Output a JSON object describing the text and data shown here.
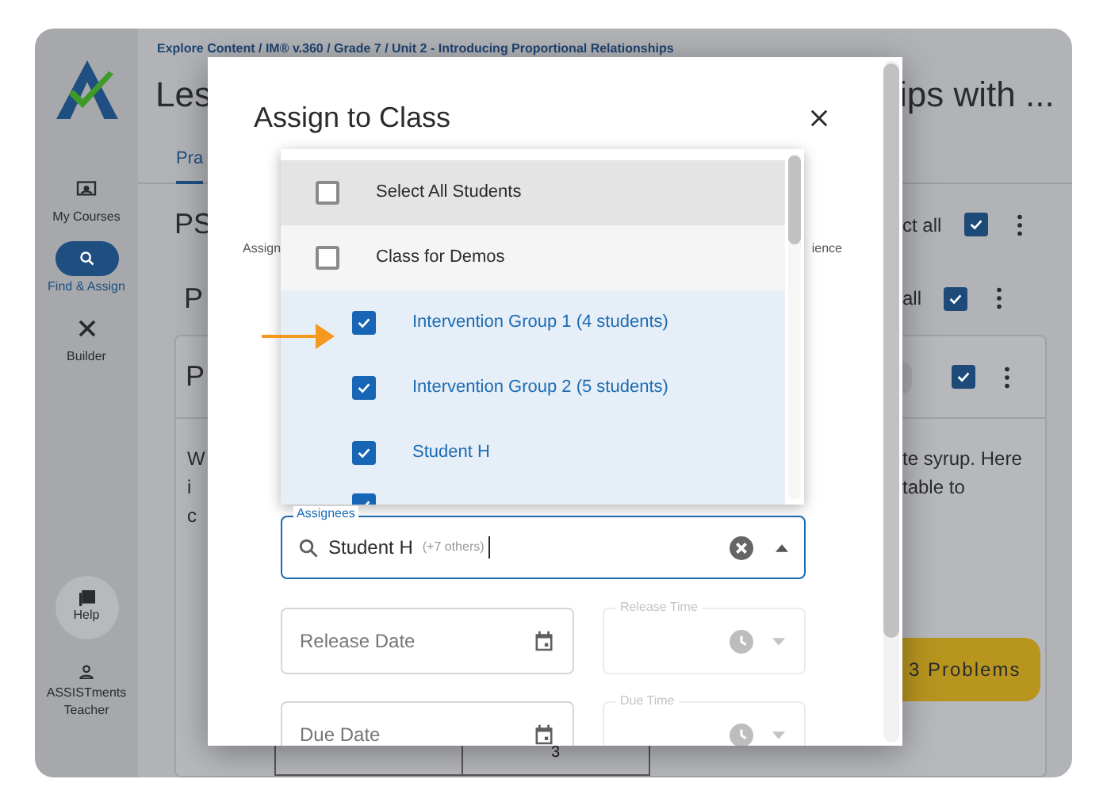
{
  "breadcrumb": "Explore Content / IM® v.360 / Grade 7 / Unit 2 - Introducing Proportional Relationships",
  "sidebar": {
    "items": [
      {
        "label": "My Courses",
        "selected": false
      },
      {
        "label": "Find & Assign",
        "selected": true
      },
      {
        "label": "Builder",
        "selected": false
      }
    ],
    "help": "Help",
    "user": "ASSISTments Teacher"
  },
  "page": {
    "title_left": "Les",
    "title_right": "ips with ...",
    "tabs": [
      {
        "label": "Pra",
        "selected": true
      }
    ],
    "sections": [
      {
        "left": "PS",
        "right": "ct all",
        "checked": true
      },
      {
        "left": "P",
        "right": "all",
        "checked": true
      }
    ],
    "card": {
      "left": "P",
      "checked": true,
      "text_left": [
        "W",
        "i",
        "c"
      ],
      "text_right": [
        "te syrup. Here",
        "table to"
      ],
      "button": "3 Problems",
      "table": {
        "column_2": "3"
      }
    }
  },
  "modal": {
    "title": "Assign to Class",
    "behind_labels": [
      "Assign",
      "ience"
    ],
    "options": [
      {
        "label": "Select All Students",
        "checked": false,
        "focused": true
      },
      {
        "label": "Class for Demos",
        "checked": false,
        "focused": false,
        "children": [
          {
            "label": "Intervention Group 1 (4 students)",
            "checked": true
          },
          {
            "label": "Intervention Group 2 (5 students)",
            "checked": true
          },
          {
            "label": "Student H",
            "checked": true
          },
          {
            "checked": true
          }
        ]
      }
    ],
    "assignees": {
      "label": "Assignees",
      "value": "Student H",
      "extra": "(+7 others)"
    },
    "fields": [
      {
        "date": "Release Date",
        "time": "Release Time",
        "time_disabled": true
      },
      {
        "date": "Due Date",
        "time": "Due Time",
        "time_disabled": true
      }
    ]
  }
}
